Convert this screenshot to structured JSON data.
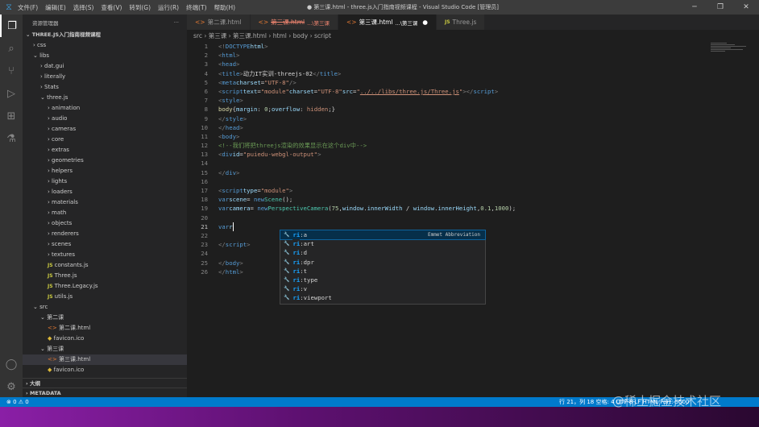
{
  "menu": [
    "文件(F)",
    "编辑(E)",
    "选择(S)",
    "查看(V)",
    "转到(G)",
    "运行(R)",
    "终端(T)",
    "帮助(H)"
  ],
  "window_title": "● 第三课.html - three.js入门指南视频课程 - Visual Studio Code [管理员]",
  "explorer": {
    "title": "资源管理器",
    "more": "···",
    "root": "THREE.JS入门指南视频课程",
    "items": [
      {
        "label": "css",
        "depth": 1,
        "type": "folder-closed"
      },
      {
        "label": "libs",
        "depth": 1,
        "type": "folder-open"
      },
      {
        "label": "dat.gui",
        "depth": 2,
        "type": "folder-closed"
      },
      {
        "label": "literally",
        "depth": 2,
        "type": "folder-closed"
      },
      {
        "label": "Stats",
        "depth": 2,
        "type": "folder-closed"
      },
      {
        "label": "three.js",
        "depth": 2,
        "type": "folder-open"
      },
      {
        "label": "animation",
        "depth": 3,
        "type": "folder-closed"
      },
      {
        "label": "audio",
        "depth": 3,
        "type": "folder-closed"
      },
      {
        "label": "cameras",
        "depth": 3,
        "type": "folder-closed"
      },
      {
        "label": "core",
        "depth": 3,
        "type": "folder-closed"
      },
      {
        "label": "extras",
        "depth": 3,
        "type": "folder-closed"
      },
      {
        "label": "geometries",
        "depth": 3,
        "type": "folder-closed"
      },
      {
        "label": "helpers",
        "depth": 3,
        "type": "folder-closed"
      },
      {
        "label": "lights",
        "depth": 3,
        "type": "folder-closed"
      },
      {
        "label": "loaders",
        "depth": 3,
        "type": "folder-closed"
      },
      {
        "label": "materials",
        "depth": 3,
        "type": "folder-closed"
      },
      {
        "label": "math",
        "depth": 3,
        "type": "folder-closed"
      },
      {
        "label": "objects",
        "depth": 3,
        "type": "folder-closed"
      },
      {
        "label": "renderers",
        "depth": 3,
        "type": "folder-closed"
      },
      {
        "label": "scenes",
        "depth": 3,
        "type": "folder-closed"
      },
      {
        "label": "textures",
        "depth": 3,
        "type": "folder-closed"
      },
      {
        "label": "constants.js",
        "depth": 3,
        "type": "js"
      },
      {
        "label": "Three.js",
        "depth": 3,
        "type": "js"
      },
      {
        "label": "Three.Legacy.js",
        "depth": 3,
        "type": "js"
      },
      {
        "label": "utils.js",
        "depth": 3,
        "type": "js"
      },
      {
        "label": "src",
        "depth": 1,
        "type": "folder-open"
      },
      {
        "label": "第二课",
        "depth": 2,
        "type": "folder-open"
      },
      {
        "label": "第二课.html",
        "depth": 3,
        "type": "html"
      },
      {
        "label": "favicon.ico",
        "depth": 3,
        "type": "ico"
      },
      {
        "label": "第三课",
        "depth": 2,
        "type": "folder-open"
      },
      {
        "label": "第三课.html",
        "depth": 3,
        "type": "html",
        "selected": true
      },
      {
        "label": "favicon.ico",
        "depth": 3,
        "type": "ico"
      }
    ],
    "outline": "大纲",
    "metadata": "METADATA"
  },
  "tabs": [
    {
      "label": "第二课.html",
      "type": "html"
    },
    {
      "label": "第三课.html",
      "suffix": "...\\第三课",
      "type": "html",
      "error": true
    },
    {
      "label": "第三课.html",
      "suffix": "...\\第三课",
      "type": "html",
      "active": true,
      "dirty": "●"
    },
    {
      "label": "Three.js",
      "type": "js"
    }
  ],
  "breadcrumb": [
    "src",
    "第三课",
    "第三课.html",
    "html",
    "body",
    "script"
  ],
  "suggest": {
    "items": [
      "ri:a",
      "ri:art",
      "ri:d",
      "ri:dpr",
      "ri:t",
      "ri:type",
      "ri:v",
      "ri:viewport"
    ],
    "match": "ri",
    "detail": "Emmet Abbreviation"
  },
  "status": {
    "left": "⊗ 0 ⚠ 0",
    "right": "行 21，列 18   空格: 4   UTF-8   LF   HTML   Port: 5500"
  },
  "watermark": "@稀土掘金技术社区"
}
